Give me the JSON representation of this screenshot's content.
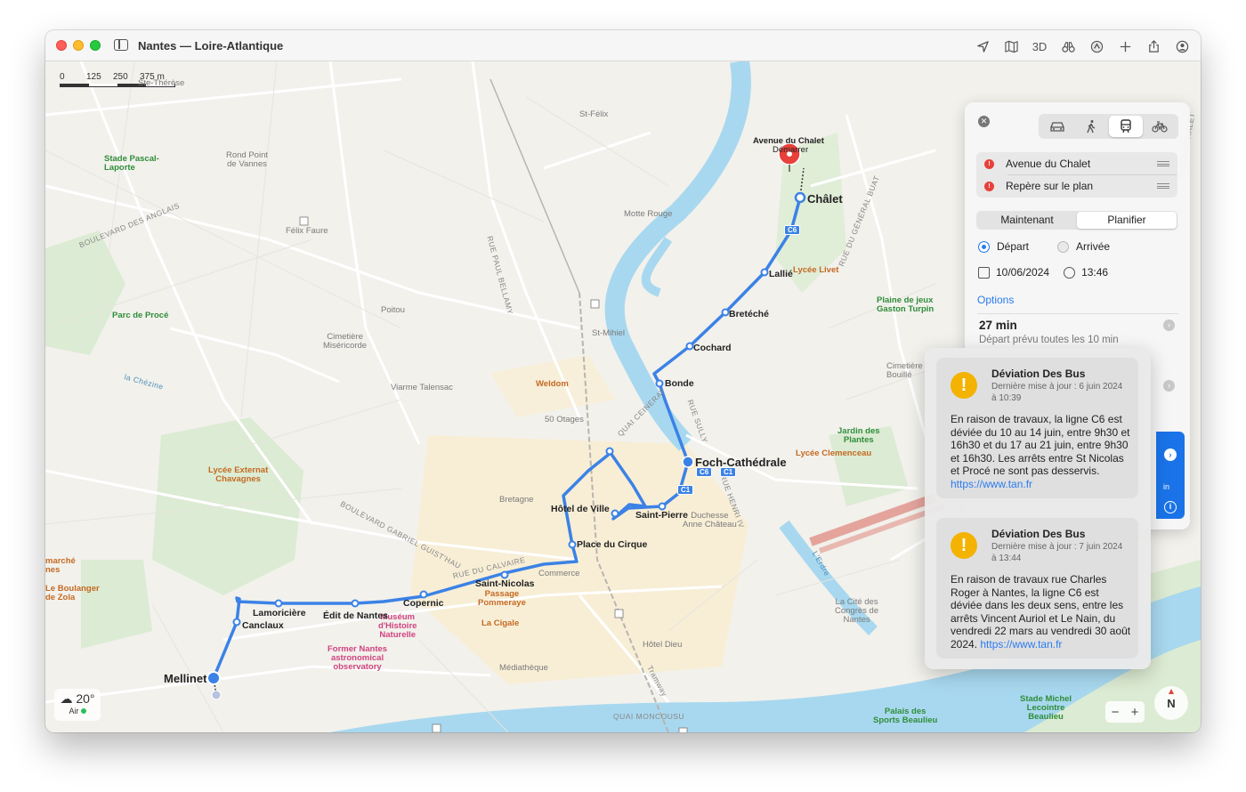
{
  "window": {
    "title": "Nantes — Loire-Atlantique"
  },
  "toolbar": {
    "threed_label": "3D"
  },
  "scale": {
    "ticks": [
      "0",
      "125",
      "250",
      "375 m"
    ]
  },
  "weather": {
    "temp": "20°",
    "air_label": "Air"
  },
  "compass": {
    "label": "N"
  },
  "zoom": {
    "minus": "−",
    "plus": "+"
  },
  "map_labels": {
    "st_felix": "St-Félix",
    "motte_rouge": "Motte Rouge",
    "st_mihiel": "St-Mihiel",
    "poitou": "Poitou",
    "felix_faure": "Félix Faure",
    "rond_point": "Rond Point\nde Vannes",
    "stade_pascal": "Stade Pascal-\nLaporte",
    "parc_proce": "Parc de Procé",
    "cimetiere_miseri": "Cimetière\nMiséricorde",
    "viarme": "Viarme Talensac",
    "weldom": "Weldom",
    "otages": "50 Otages",
    "bretagne": "Bretagne",
    "commerce": "Commerce",
    "lycee_externat": "Lycée Externat\nChavagnes",
    "lycee_livet": "Lycée Livet",
    "lycee_clemenceau": "Lycée Clemenceau",
    "plaine_jeux": "Plaine de jeux\nGaston Turpin",
    "jardin_plantes": "Jardin des\nPlantes",
    "cimetiere_bouill": "Cimetière\nBouillé",
    "duchesse": "Duchesse\nAnne Château",
    "passage": "Passage\nPommeraye",
    "la_cigale": "La Cigale",
    "museum": "Muséum\nd'Histoire\nNaturelle",
    "observatory": "Former Nantes\nastronomical\nobservatory",
    "mediatheque": "Médiathèque",
    "hotel_dieu": "Hôtel Dieu",
    "cite_congres": "La Cité des\nCongrès de\nNantes",
    "stade_michel": "Stade Michel\nLecointre\nBeaulieu",
    "palais_sports": "Palais des\nSports Beaulieu",
    "marche": "marché\nnes",
    "boulanger": "Le Boulanger\nde Zola",
    "therese": "Ste-Thérèse",
    "erdre": "L'Erdre",
    "chezine": "la Chézine",
    "quai_moncousu": "QUAI MONCOUSU",
    "rue_paul_bellamy": "RUE PAUL BELLAMY",
    "bd_anglais": "BOULEVARD DES ANGLAIS",
    "quai_ceineray": "QUAI CEINERAY",
    "rue_sully": "RUE SULLY",
    "rue_henri": "RUE HENRI IV",
    "bd_gabriel": "BOULEVARD GABRIEL GUIST'HAU",
    "rue_calvaire": "RUE DU CALVAIRE",
    "rue_general": "RUE DU GÉNÉRAL BUAT",
    "rue_chalet": "RUE DU CHALET",
    "tramway": "Tramway"
  },
  "route": {
    "destination_pin_label": "Avenue du Chalet",
    "start_label": "Démarrer",
    "stops": {
      "chalet": "Châlet",
      "lallie": "Lallié",
      "breteche": "Bretéché",
      "cochard": "Cochard",
      "bonde": "Bonde",
      "foch": "Foch-Cathédrale",
      "saint_pierre": "Saint-Pierre",
      "hotel_ville": "Hôtel de Ville",
      "place_cirque": "Place du Cirque",
      "saint_nicolas": "Saint-Nicolas",
      "copernic": "Copernic",
      "edit": "Édit de Nantes",
      "lamoriciere": "Lamoricière",
      "canclaux": "Canclaux",
      "mellinet": "Mellinet"
    },
    "badges": {
      "c6": "C6",
      "c1": "C1"
    },
    "route_color": "#3b82e6"
  },
  "panel": {
    "waypoints": [
      "Avenue du Chalet",
      "Repère sur le plan"
    ],
    "segment": {
      "now": "Maintenant",
      "plan": "Planifier",
      "active": "plan"
    },
    "radio": {
      "depart": "Départ",
      "arrival": "Arrivée",
      "selected": "depart"
    },
    "date": "10/06/2024",
    "time": "13:46",
    "options_label": "Options",
    "route_summary": {
      "duration": "27 min",
      "frequency": "Départ prévu toutes les 10 min"
    },
    "blue_card_snippet": "in"
  },
  "alerts": [
    {
      "title": "Déviation Des Bus",
      "updated": "Dernière mise à jour : 6 juin 2024 à 10:39",
      "body": "En raison de travaux, la ligne C6 est déviée du 10 au 14 juin, entre 9h30 et 16h30 et du 17 au 21 juin, entre 9h30 et 16h30. Les arrêts entre St Nicolas et Procé ne sont pas desservis.",
      "link": "https://www.tan.fr"
    },
    {
      "title": "Déviation Des Bus",
      "updated": "Dernière mise à jour : 7 juin 2024 à 13:44",
      "body": "En raison de travaux rue Charles Roger à Nantes, la ligne C6 est déviée dans les deux sens, entre les arrêts Vincent Auriol et Le Nain, du vendredi 22 mars au vendredi 30 août 2024.",
      "link": "https://www.tan.fr"
    }
  ],
  "colors": {
    "accent": "#2a7bf0",
    "warning": "#f3b300",
    "water": "#a8d8ef",
    "park": "#d9ead1"
  }
}
